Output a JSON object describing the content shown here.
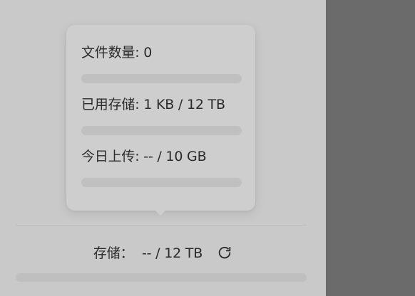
{
  "popover": {
    "file_count_label": "文件数量: 0",
    "used_storage_label": "已用存储: 1 KB / 12 TB",
    "today_upload_label": "今日上传: -- / 10 GB",
    "file_count_progress": 0,
    "used_storage_progress": 0,
    "today_upload_progress": 0
  },
  "footer": {
    "storage_label": "存储：  -- / 12 TB",
    "refresh_icon": "refresh-icon",
    "storage_progress": 0
  },
  "colors": {
    "panel_bg": "#c9c9c9",
    "overlay_bg": "#6b6b6b",
    "popover_bg": "#cecece",
    "track_bg": "#c0c0c0",
    "text": "#2a2a2a"
  }
}
